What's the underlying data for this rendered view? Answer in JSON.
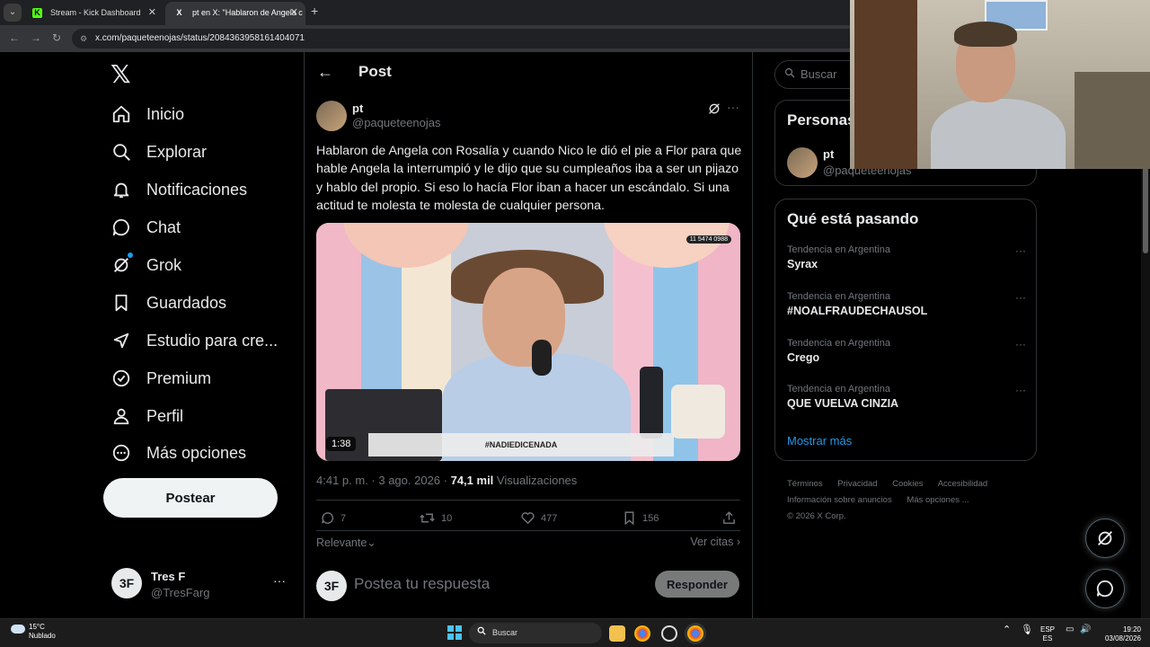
{
  "browser": {
    "tabs": [
      {
        "label": "Stream - Kick Dashboard",
        "favicon": "K",
        "favicon_color": "#53fc18",
        "active": false
      },
      {
        "label": "pt en X: \"Hablaron de Angela c",
        "favicon": "X",
        "favicon_color": "#ffffff",
        "active": true
      }
    ],
    "url": "x.com/paqueteenojas/status/2084363958161404071"
  },
  "nav": {
    "items": [
      {
        "label": "Inicio",
        "icon": "home-icon"
      },
      {
        "label": "Explorar",
        "icon": "search-icon"
      },
      {
        "label": "Notificaciones",
        "icon": "bell-icon"
      },
      {
        "label": "Chat",
        "icon": "chat-icon"
      },
      {
        "label": "Grok",
        "icon": "grok-icon"
      },
      {
        "label": "Guardados",
        "icon": "bookmark-icon"
      },
      {
        "label": "Estudio para cre...",
        "icon": "rocket-icon"
      },
      {
        "label": "Premium",
        "icon": "verified-icon"
      },
      {
        "label": "Perfil",
        "icon": "person-icon"
      },
      {
        "label": "Más opciones",
        "icon": "more-circle-icon"
      }
    ],
    "post_button": "Postear",
    "account": {
      "avatar": "3F",
      "name": "Tres F",
      "handle": "@TresFarg"
    }
  },
  "post": {
    "header_title": "Post",
    "author": {
      "name": "pt",
      "handle": "@paqueteenojas"
    },
    "text": "Hablaron de Angela con Rosalía y cuando Nico le dió el pie a Flor para que hable Angela la interrumpió y le dijo que su cumpleaños iba a ser un pijazo y hablo del propio. Si eso lo hacía Flor iban a hacer un escándalo. Si una actitud te molesta te molesta de cualquier persona.",
    "media": {
      "duration": "1:38",
      "lower_third": "#NADIEDICENADA",
      "phone": "11 5474 0988"
    },
    "meta": {
      "time": "4:41 p. m. · 3 ago. 2026 · ",
      "views": "74,1 mil",
      "views_label": " Visualizaciones"
    },
    "stats": {
      "replies": "7",
      "reposts": "10",
      "likes": "477",
      "bookmarks": "156"
    },
    "sort_label": "Relevante",
    "quotes_label": "Ver citas",
    "reply_placeholder": "Postea tu respuesta",
    "reply_button": "Responder"
  },
  "sidebar": {
    "search_placeholder": "Buscar",
    "who_title": "Personas",
    "who": {
      "name": "pt",
      "handle": "@paqueteenojas"
    },
    "trends_title": "Qué está pasando",
    "trends": [
      {
        "context": "Tendencia en Argentina",
        "topic": "Syrax"
      },
      {
        "context": "Tendencia en Argentina",
        "topic": "#NOALFRAUDECHAUSOL"
      },
      {
        "context": "Tendencia en Argentina",
        "topic": "Crego"
      },
      {
        "context": "Tendencia en Argentina",
        "topic": "QUE VUELVA CINZIA"
      }
    ],
    "show_more": "Mostrar más",
    "footer": {
      "links1": [
        "Términos",
        "Privacidad",
        "Cookies",
        "Accesibilidad"
      ],
      "links2": [
        "Información sobre anuncios",
        "Más opciones ..."
      ],
      "copyright": "© 2026 X Corp."
    }
  },
  "taskbar": {
    "weather_temp": "15°C",
    "weather_desc": "Nublado",
    "search": "Buscar",
    "lang1": "ESP",
    "lang2": "ES",
    "time": "19:20",
    "date": "03/08/2026"
  },
  "colors": {
    "accent": "#1d9bf0",
    "border": "#2f3336",
    "muted": "#71767b"
  }
}
